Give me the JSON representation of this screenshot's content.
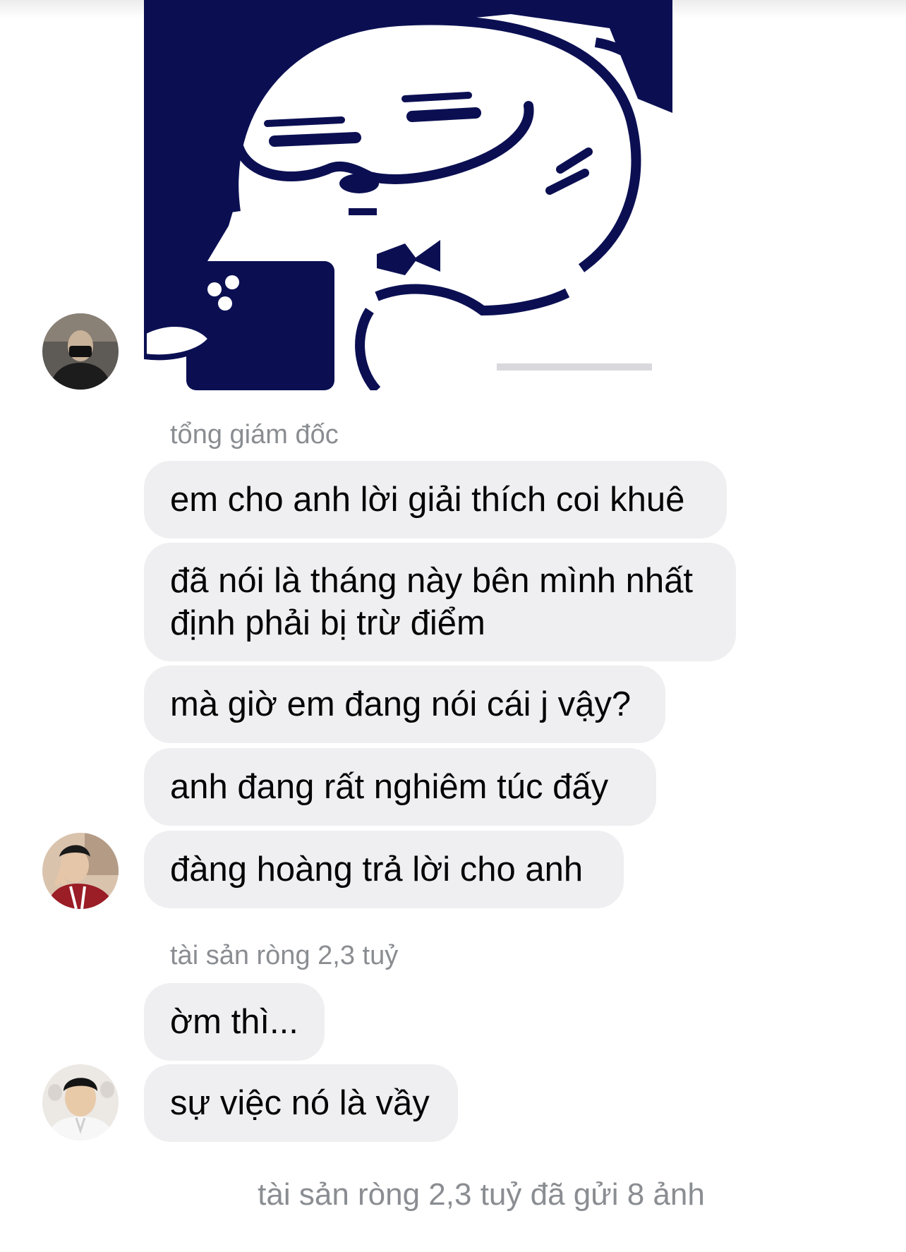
{
  "conversation": {
    "sticker": {
      "description_icon": "meme-cat-sticker"
    },
    "groups": [
      {
        "sender_name": "tổng giám đốc",
        "messages": [
          "em cho anh lời giải thích coi khuê",
          "đã nói là tháng này bên mình nhất định phải bị trừ điểm",
          "mà giờ em đang nói cái j vậy?",
          "anh đang rất nghiêm túc đấy",
          "đàng hoàng trả lời cho anh"
        ]
      },
      {
        "sender_name": "tài sản ròng 2,3 tuỷ",
        "messages": [
          "ờm thì...",
          "sự việc nó là vầy"
        ]
      }
    ],
    "footer_note": "tài sản ròng 2,3 tuỷ đã gửi 8 ảnh"
  },
  "colors": {
    "bubble_bg": "#efeff1",
    "sender_text": "#8a8d91",
    "message_text": "#050505",
    "sticker_ink": "#0b0f52"
  }
}
